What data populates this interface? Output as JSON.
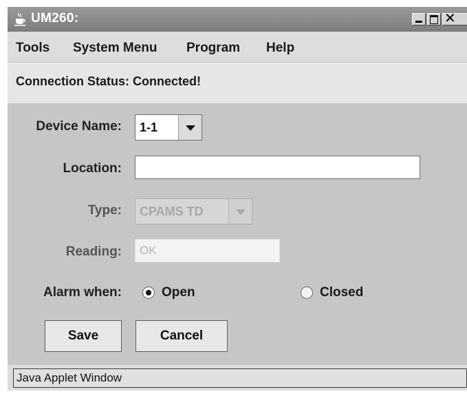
{
  "window": {
    "title": "UM260:",
    "icon": "java-cup-icon",
    "controls": [
      "minimize",
      "maximize",
      "close"
    ]
  },
  "menu": {
    "items": [
      {
        "label": "Tools"
      },
      {
        "label": "System Menu"
      },
      {
        "label": "Program"
      },
      {
        "label": "Help"
      }
    ]
  },
  "status": {
    "text": "Connection Status: Connected!"
  },
  "form": {
    "device_name": {
      "label": "Device Name:",
      "value": "1-1"
    },
    "location": {
      "label": "Location:",
      "value": ""
    },
    "type": {
      "label": "Type:",
      "value": "CPAMS TD",
      "enabled": false
    },
    "reading": {
      "label": "Reading:",
      "value": "OK",
      "enabled": false
    },
    "alarm_when": {
      "label": "Alarm when:",
      "options": [
        {
          "label": "Open",
          "selected": true
        },
        {
          "label": "Closed",
          "selected": false
        }
      ]
    }
  },
  "buttons": {
    "save": "Save",
    "cancel": "Cancel"
  },
  "footer": {
    "text": "Java Applet Window"
  }
}
